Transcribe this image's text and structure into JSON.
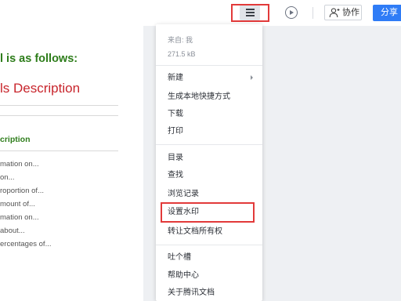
{
  "toolbar": {
    "menu_icon": "hamburger-menu-icon",
    "present_icon": "play-circle-icon",
    "collab_icon": "user-add-icon",
    "collab_label": "协作",
    "share_label": "分享",
    "accent_color": "#2f7cf6",
    "highlight_color": "#e23a3a"
  },
  "document": {
    "heading": "l is as follows:",
    "subheading": "ls Description",
    "section_title": "cription",
    "lines": [
      "mation on...",
      "on...",
      "roportion of...",
      "mount of...",
      "mation on...",
      "about...",
      "ercentages of..."
    ],
    "heading_color": "#2e7d1b",
    "subheading_color": "#c8252c"
  },
  "menu": {
    "source": "来自: 我",
    "size": "271.5 kB",
    "items": [
      {
        "label": "新建"
      },
      {
        "label": "生成本地快捷方式"
      },
      {
        "label": "下载"
      },
      {
        "label": "打印"
      },
      {
        "label": "目录"
      },
      {
        "label": "查找"
      },
      {
        "label": "浏览记录"
      },
      {
        "label": "设置水印"
      },
      {
        "label": "转让文档所有权"
      },
      {
        "label": "吐个槽"
      },
      {
        "label": "帮助中心"
      },
      {
        "label": "关于腾讯文档"
      }
    ]
  }
}
